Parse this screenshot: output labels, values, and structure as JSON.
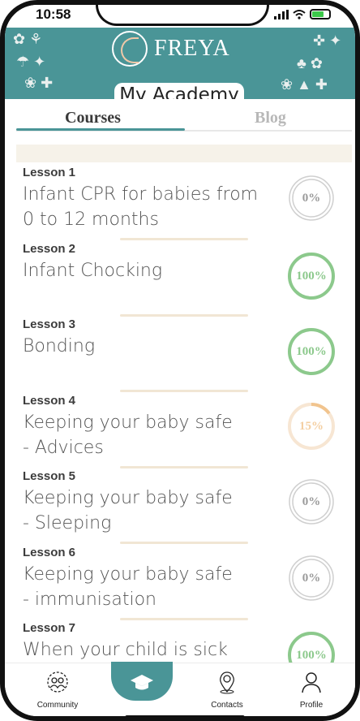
{
  "status_bar": {
    "time": "10:58"
  },
  "header": {
    "brand": "FREYA",
    "section_title": "My Academy",
    "colors": {
      "teal": "#4a9597",
      "cream": "#f6f2e9"
    }
  },
  "tabs": [
    {
      "label": "Courses",
      "active": true
    },
    {
      "label": "Blog",
      "active": false
    }
  ],
  "lessons": [
    {
      "number": "Lesson 1",
      "title_lines": [
        "Infant CPR for babies from",
        "0 to 12 months"
      ],
      "progress": 0,
      "progress_label": "0%",
      "color": "#c4c4c4"
    },
    {
      "number": "Lesson 2",
      "title_lines": [
        "Infant Chocking"
      ],
      "progress": 100,
      "progress_label": "100%",
      "color": "#8cc98c"
    },
    {
      "number": "Lesson 3",
      "title_lines": [
        "Bonding"
      ],
      "progress": 100,
      "progress_label": "100%",
      "color": "#8cc98c"
    },
    {
      "number": "Lesson 4",
      "title_lines": [
        "Keeping your baby safe",
        "- Advices"
      ],
      "progress": 15,
      "progress_label": "15%",
      "color": "#f4cfa2"
    },
    {
      "number": "Lesson 5",
      "title_lines": [
        "Keeping your baby safe",
        "- Sleeping"
      ],
      "progress": 0,
      "progress_label": "0%",
      "color": "#c4c4c4"
    },
    {
      "number": "Lesson 6",
      "title_lines": [
        "Keeping your baby safe",
        "- immunisation"
      ],
      "progress": 0,
      "progress_label": "0%",
      "color": "#c4c4c4"
    },
    {
      "number": "Lesson 7",
      "title_lines": [
        "When your child is sick"
      ],
      "progress": 100,
      "progress_label": "100%",
      "color": "#8cc98c"
    }
  ],
  "bottom_nav": [
    {
      "label": "Community",
      "icon": "community-icon",
      "active": false
    },
    {
      "label": "Academy",
      "icon": "graduation-cap-icon",
      "active": true
    },
    {
      "label": "Contacts",
      "icon": "location-pin-icon",
      "active": false
    },
    {
      "label": "Profile",
      "icon": "person-icon",
      "active": false
    }
  ]
}
